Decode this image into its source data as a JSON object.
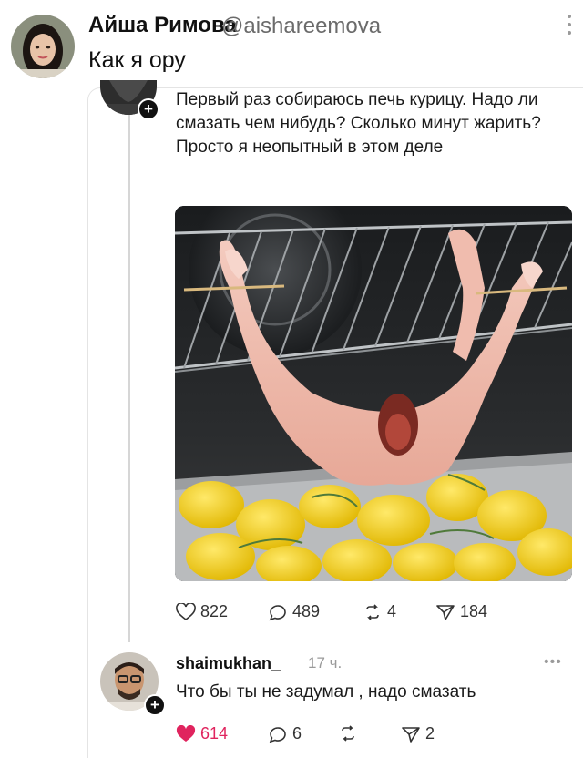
{
  "post": {
    "author_name": "Айша Римова",
    "author_handle": "@aishareemova",
    "text": "Как я ору"
  },
  "quoted_post": {
    "text": "Первый раз собираюсь печь курицу. Надо ли смазать чем нибудь? Сколько минут жарить? Просто я неопытный в этом деле",
    "image_description": "raw chicken hanging from oven rack over potatoes",
    "stats": {
      "likes": "822",
      "comments": "489",
      "reposts": "4",
      "shares": "184"
    }
  },
  "reply": {
    "username": "shaimukhan_",
    "time": "17 ч.",
    "text": "Что бы ты не задумал , надо смазать",
    "stats": {
      "likes": "614",
      "comments": "6",
      "shares": "2"
    }
  },
  "colors": {
    "like_active": "#e0245e",
    "muted": "#9a9a9a",
    "text": "#111111"
  }
}
